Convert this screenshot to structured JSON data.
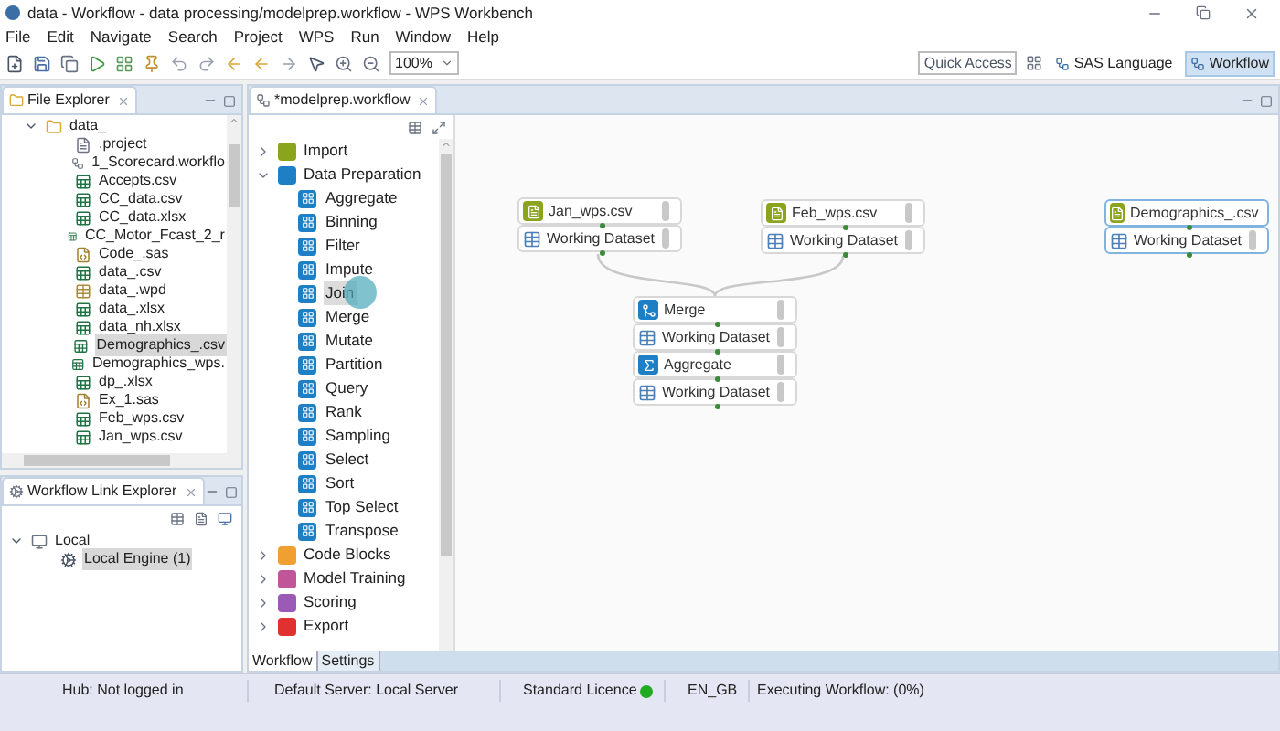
{
  "window": {
    "title": "data - Workflow - data processing/modelprep.workflow - WPS Workbench"
  },
  "menu": [
    "File",
    "Edit",
    "Navigate",
    "Search",
    "Project",
    "WPS",
    "Run",
    "Window",
    "Help"
  ],
  "toolbar": {
    "zoom": "100%"
  },
  "quick_access": "Quick Access",
  "perspectives": [
    {
      "label": "SAS Language",
      "selected": false
    },
    {
      "label": "Workflow",
      "selected": true
    }
  ],
  "file_explorer": {
    "title": "File Explorer",
    "tree": [
      {
        "label": "data_",
        "kind": "folder",
        "expanded": true,
        "selected": false,
        "children": [
          {
            "label": ".project",
            "kind": "text",
            "selected": false
          },
          {
            "label": "1_Scorecard.workflo",
            "kind": "workflow",
            "selected": false
          },
          {
            "label": "Accepts.csv",
            "kind": "sheet",
            "selected": false
          },
          {
            "label": "CC_data.csv",
            "kind": "sheet",
            "selected": false
          },
          {
            "label": "CC_data.xlsx",
            "kind": "sheet",
            "selected": false
          },
          {
            "label": "CC_Motor_Fcast_2_r",
            "kind": "sheet",
            "selected": false
          },
          {
            "label": "Code_.sas",
            "kind": "sas",
            "selected": false
          },
          {
            "label": "data_.csv",
            "kind": "sheet",
            "selected": false
          },
          {
            "label": "data_.wpd",
            "kind": "table",
            "selected": false
          },
          {
            "label": "data_.xlsx",
            "kind": "sheet",
            "selected": false
          },
          {
            "label": "data_nh.xlsx",
            "kind": "sheet",
            "selected": false
          },
          {
            "label": "Demographics_.csv",
            "kind": "sheet",
            "selected": true
          },
          {
            "label": "Demographics_wps.",
            "kind": "sheet",
            "selected": false
          },
          {
            "label": "dp_.xlsx",
            "kind": "sheet",
            "selected": false
          },
          {
            "label": "Ex_1.sas",
            "kind": "sas",
            "selected": false
          },
          {
            "label": "Feb_wps.csv",
            "kind": "sheet",
            "selected": false
          },
          {
            "label": "Jan_wps.csv",
            "kind": "sheet",
            "selected": false
          }
        ]
      }
    ]
  },
  "link_explorer": {
    "title": "Workflow Link Explorer",
    "tree": [
      {
        "label": "Local",
        "kind": "host",
        "expanded": true,
        "selected": false,
        "children": [
          {
            "label": "Local Engine (1)",
            "kind": "engine",
            "selected": true
          }
        ]
      }
    ]
  },
  "editor_tab": "*modelprep.workflow",
  "palette": [
    {
      "label": "Import",
      "color": "#8aa51c",
      "expanded": false
    },
    {
      "label": "Data Preparation",
      "color": "#1f7fc4",
      "expanded": true,
      "children": [
        {
          "label": "Aggregate",
          "selected": false,
          "hovered": false
        },
        {
          "label": "Binning",
          "selected": false,
          "hovered": false
        },
        {
          "label": "Filter",
          "selected": false,
          "hovered": false
        },
        {
          "label": "Impute",
          "selected": false,
          "hovered": false
        },
        {
          "label": "Join",
          "selected": true,
          "hovered": true
        },
        {
          "label": "Merge",
          "selected": false,
          "hovered": false
        },
        {
          "label": "Mutate",
          "selected": false,
          "hovered": false
        },
        {
          "label": "Partition",
          "selected": false,
          "hovered": false
        },
        {
          "label": "Query",
          "selected": false,
          "hovered": false
        },
        {
          "label": "Rank",
          "selected": false,
          "hovered": false
        },
        {
          "label": "Sampling",
          "selected": false,
          "hovered": false
        },
        {
          "label": "Select",
          "selected": false,
          "hovered": false
        },
        {
          "label": "Sort",
          "selected": false,
          "hovered": false
        },
        {
          "label": "Top Select",
          "selected": false,
          "hovered": false
        },
        {
          "label": "Transpose",
          "selected": false,
          "hovered": false
        }
      ]
    },
    {
      "label": "Code Blocks",
      "color": "#f0a030",
      "expanded": false
    },
    {
      "label": "Model Training",
      "color": "#c0559a",
      "expanded": false
    },
    {
      "label": "Scoring",
      "color": "#9b5ab5",
      "expanded": false
    },
    {
      "label": "Export",
      "color": "#e03030",
      "expanded": false
    }
  ],
  "editor_tabs": [
    {
      "label": "Workflow",
      "selected": true
    },
    {
      "label": "Settings",
      "selected": false
    }
  ],
  "canvas": {
    "nodes": [
      {
        "selected": false,
        "blocks": [
          {
            "kind": "source",
            "label": "Jan_wps.csv"
          },
          {
            "kind": "dataset",
            "label": "Working Dataset"
          }
        ]
      },
      {
        "selected": false,
        "blocks": [
          {
            "kind": "source",
            "label": "Feb_wps.csv"
          },
          {
            "kind": "dataset",
            "label": "Working Dataset"
          }
        ]
      },
      {
        "selected": true,
        "blocks": [
          {
            "kind": "source",
            "label": "Demographics_.csv"
          },
          {
            "kind": "dataset",
            "label": "Working Dataset"
          }
        ]
      },
      {
        "selected": false,
        "blocks": [
          {
            "kind": "merge",
            "label": "Merge"
          },
          {
            "kind": "dataset",
            "label": "Working Dataset"
          },
          {
            "kind": "aggregate",
            "label": "Aggregate"
          },
          {
            "kind": "dataset",
            "label": "Working Dataset"
          }
        ]
      }
    ]
  },
  "status_bar": {
    "hub": "Hub: Not logged in",
    "server": "Default Server: Local Server",
    "licence": "Standard Licence",
    "licence_ok": true,
    "locale": "EN_GB",
    "progress": "Executing Workflow: (0%)"
  }
}
